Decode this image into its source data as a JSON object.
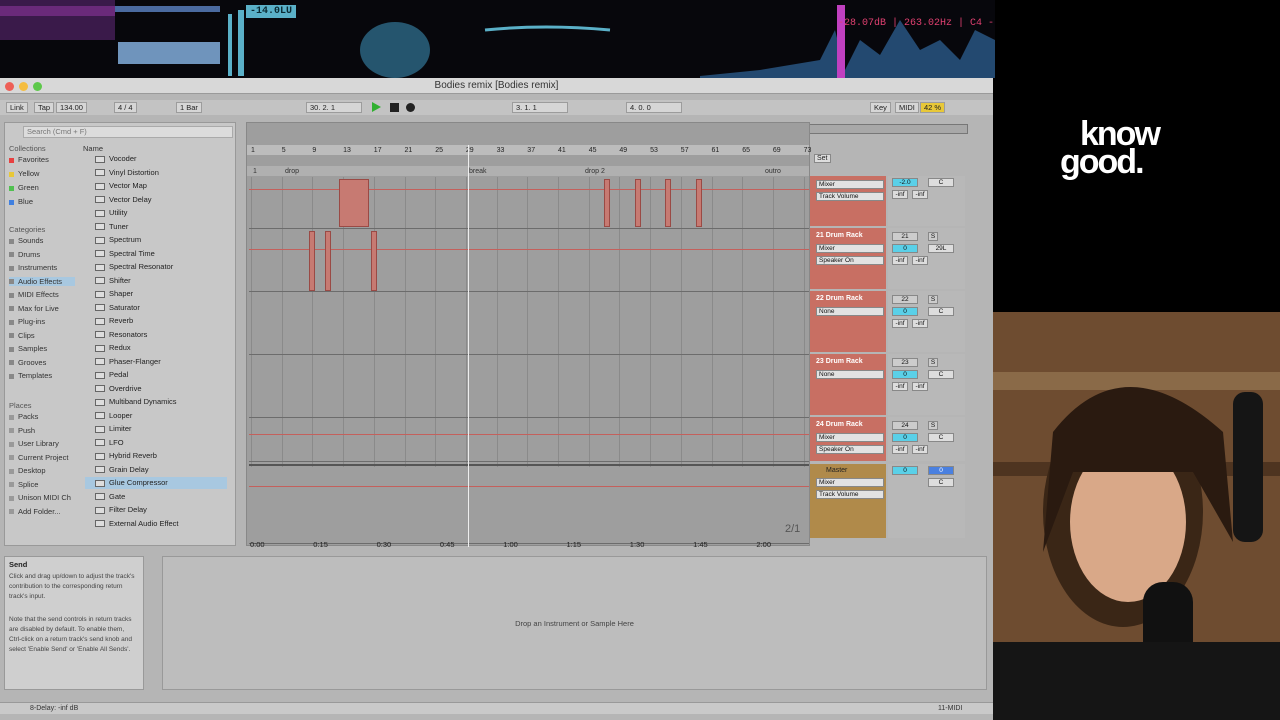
{
  "overlay": {
    "lufs_readout": "-14.0LU",
    "spectrum_readout": "-28.07dB | 263.02Hz | C4 -",
    "brand_line1": "know",
    "brand_line2": "good."
  },
  "window": {
    "title": "Bodies remix  [Bodies remix]"
  },
  "control_bar": {
    "link": "Link",
    "tap": "Tap",
    "tempo": "134.00",
    "time_sig": "4 / 4",
    "quantize": "1 Bar",
    "arrangement_pos": "30.   2.   1",
    "loop_start": "3.   1.   1",
    "loop_length": "4.   0.   0",
    "key": "Key",
    "midi": "MIDI",
    "cpu": "42 %"
  },
  "browser": {
    "search_placeholder": "Search (Cmd + F)",
    "collections_label": "Collections",
    "collections": [
      {
        "label": "Favorites",
        "color": "#e84040"
      },
      {
        "label": "Yellow",
        "color": "#e8c838"
      },
      {
        "label": "Green",
        "color": "#50c050"
      },
      {
        "label": "Blue",
        "color": "#4080e0"
      }
    ],
    "categories_label": "Categories",
    "categories": [
      "Sounds",
      "Drums",
      "Instruments",
      "Audio Effects",
      "MIDI Effects",
      "Max for Live",
      "Plug-ins",
      "Clips",
      "Samples",
      "Grooves",
      "Templates"
    ],
    "selected_category": "Audio Effects",
    "places_label": "Places",
    "places": [
      "Packs",
      "Push",
      "User Library",
      "Current Project",
      "Desktop",
      "Splice",
      "Unison MIDI Ch",
      "Add Folder..."
    ],
    "name_header": "Name",
    "items": [
      "Vocoder",
      "Vinyl Distortion",
      "Vector Map",
      "Vector Delay",
      "Utility",
      "Tuner",
      "Spectrum",
      "Spectral Time",
      "Spectral Resonator",
      "Shifter",
      "Shaper",
      "Saturator",
      "Reverb",
      "Resonators",
      "Redux",
      "Phaser-Flanger",
      "Pedal",
      "Overdrive",
      "Multiband Dynamics",
      "Looper",
      "Limiter",
      "LFO",
      "Hybrid Reverb",
      "Grain Delay",
      "Glue Compressor",
      "Gate",
      "Filter Delay",
      "External Audio Effect"
    ],
    "selected_item": "Glue Compressor"
  },
  "arrangement": {
    "bars": [
      "1",
      "5",
      "9",
      "13",
      "17",
      "21",
      "25",
      "29",
      "33",
      "37",
      "41",
      "45",
      "49",
      "53",
      "57",
      "61",
      "65",
      "69",
      "73"
    ],
    "locators": [
      "1",
      "drop",
      "break",
      "drop 2",
      "outro"
    ],
    "times": [
      "0:00",
      "0:15",
      "0:30",
      "0:45",
      "1:00",
      "1:15",
      "1:30",
      "1:45",
      "2:00"
    ],
    "page": "2/1",
    "set_label": "Set"
  },
  "tracks": [
    {
      "name": "",
      "chooser": "Mixer",
      "control": "Track Volume",
      "number": "",
      "vol": "-2.0",
      "pan": "C",
      "peak1": "-inf",
      "peak2": "-inf"
    },
    {
      "name": "21 Drum Rack",
      "chooser": "Mixer",
      "control": "Speaker On",
      "number": "21",
      "vol": "0",
      "pan": "29L",
      "peak1": "-inf",
      "peak2": "-inf"
    },
    {
      "name": "22 Drum Rack",
      "chooser": "None",
      "control": "",
      "number": "22",
      "vol": "0",
      "pan": "C",
      "peak1": "-inf",
      "peak2": "-inf"
    },
    {
      "name": "23 Drum Rack",
      "chooser": "None",
      "control": "",
      "number": "23",
      "vol": "0",
      "pan": "C",
      "peak1": "-inf",
      "peak2": "-inf"
    },
    {
      "name": "24 Drum Rack",
      "chooser": "Mixer",
      "control": "Speaker On",
      "number": "24",
      "vol": "0",
      "pan": "C",
      "peak1": "-inf",
      "peak2": "-inf"
    }
  ],
  "master": {
    "name": "Master",
    "chooser": "Mixer",
    "control": "Track Volume",
    "vol": "0",
    "vol2": "0",
    "pan": "C"
  },
  "solo": "S",
  "detail": {
    "title": "Send",
    "text1": "Click and drag up/down to adjust the track's contribution to the corresponding return track's input.",
    "text2": "Note that the send controls in return tracks are disabled by default. To enable them, Ctrl-click on a return track's send knob and select 'Enable Send' or 'Enable All Sends'."
  },
  "dropzone_text": "Drop an Instrument or Sample Here",
  "status": {
    "left": "8-Delay: -inf dB",
    "right": "11-MIDI"
  },
  "colors": {
    "track_red": "#c86f63",
    "master": "#b08a4a",
    "accent_cyan": "#5ad0e8"
  }
}
